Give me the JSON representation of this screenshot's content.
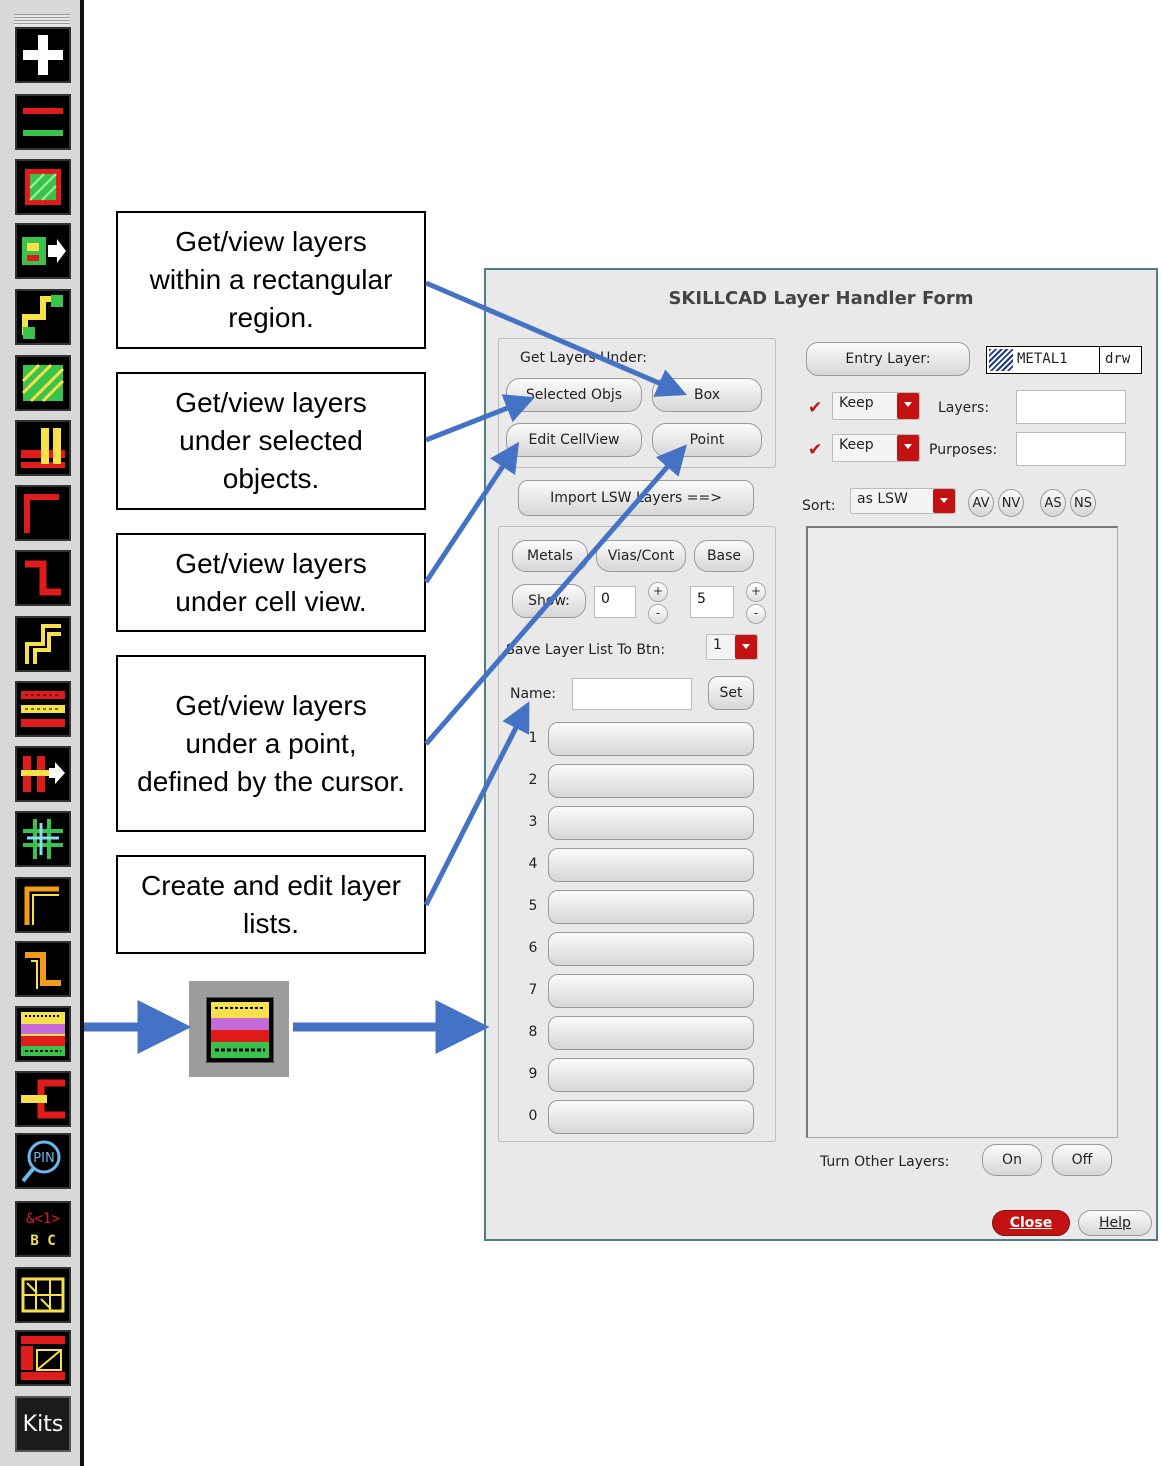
{
  "toolbar": {
    "buttons": [
      {
        "icon": "plus-icon"
      },
      {
        "icon": "red-green-lines-icon"
      },
      {
        "icon": "hatched-square-icon"
      },
      {
        "icon": "shapes-arrow-icon"
      },
      {
        "icon": "step-path-icon"
      },
      {
        "icon": "hatched-blocks-icon"
      },
      {
        "icon": "bars-grid-icon"
      },
      {
        "icon": "red-corner-icon"
      },
      {
        "icon": "red-zigzag-icon"
      },
      {
        "icon": "yellow-step-icon"
      },
      {
        "icon": "striped-bars-icon"
      },
      {
        "icon": "red-bars-arrow-icon"
      },
      {
        "icon": "crosshair-grid-icon"
      },
      {
        "icon": "orange-corner-icon"
      },
      {
        "icon": "orange-zigzag-icon"
      },
      {
        "icon": "layer-handler-icon"
      },
      {
        "icon": "red-bracket-icon"
      },
      {
        "icon": "pin-search-icon"
      },
      {
        "icon": "bus-label-icon"
      },
      {
        "icon": "yellow-grid-icon"
      },
      {
        "icon": "red-blocks-icon"
      }
    ],
    "kits_label": "Kits",
    "bus_label_top": "&<1>",
    "bus_label_bottom": "B C",
    "pin_label": "PIN"
  },
  "callouts": [
    "Get/view layers within a rectangular region.",
    "Get/view layers under selected objects.",
    "Get/view layers under cell view.",
    "Get/view layers under a point, defined by the cursor.",
    "Create and edit layer lists."
  ],
  "colors": {
    "arrow": "#4472c4",
    "dialog_border": "#4e7d86",
    "close_button": "#c41212"
  },
  "dialog": {
    "title": "SKILLCAD Layer Handler Form",
    "get_layers_under": "Get Layers Under:",
    "selected_objs": "Selected Objs",
    "box": "Box",
    "edit_cellview": "Edit CellView",
    "point": "Point",
    "import_lsw": "Import LSW Layers ==>",
    "metals": "Metals",
    "vias_cont": "Vias/Cont",
    "base": "Base",
    "show": "Show:",
    "show_from": "0",
    "show_to": "5",
    "plus": "+",
    "minus": "-",
    "save_layer_list": "Save Layer List To Btn:",
    "save_btn_value": "1",
    "name_label": "Name:",
    "name_value": "",
    "set": "Set",
    "list_numbers": [
      "1",
      "2",
      "3",
      "4",
      "5",
      "6",
      "7",
      "8",
      "9",
      "0"
    ],
    "entry_layer": "Entry Layer:",
    "entry_layer_name": "METAL1",
    "entry_layer_purpose": "drw",
    "keep1": "Keep",
    "layers_label": "Layers:",
    "keep2": "Keep",
    "purposes_label": "Purposes:",
    "sort_label": "Sort:",
    "sort_value": "as LSW",
    "av": "AV",
    "nv": "NV",
    "as": "AS",
    "ns": "NS",
    "turn_other_layers": "Turn Other Layers:",
    "on": "On",
    "off": "Off",
    "close": "Close",
    "help": "Help"
  }
}
